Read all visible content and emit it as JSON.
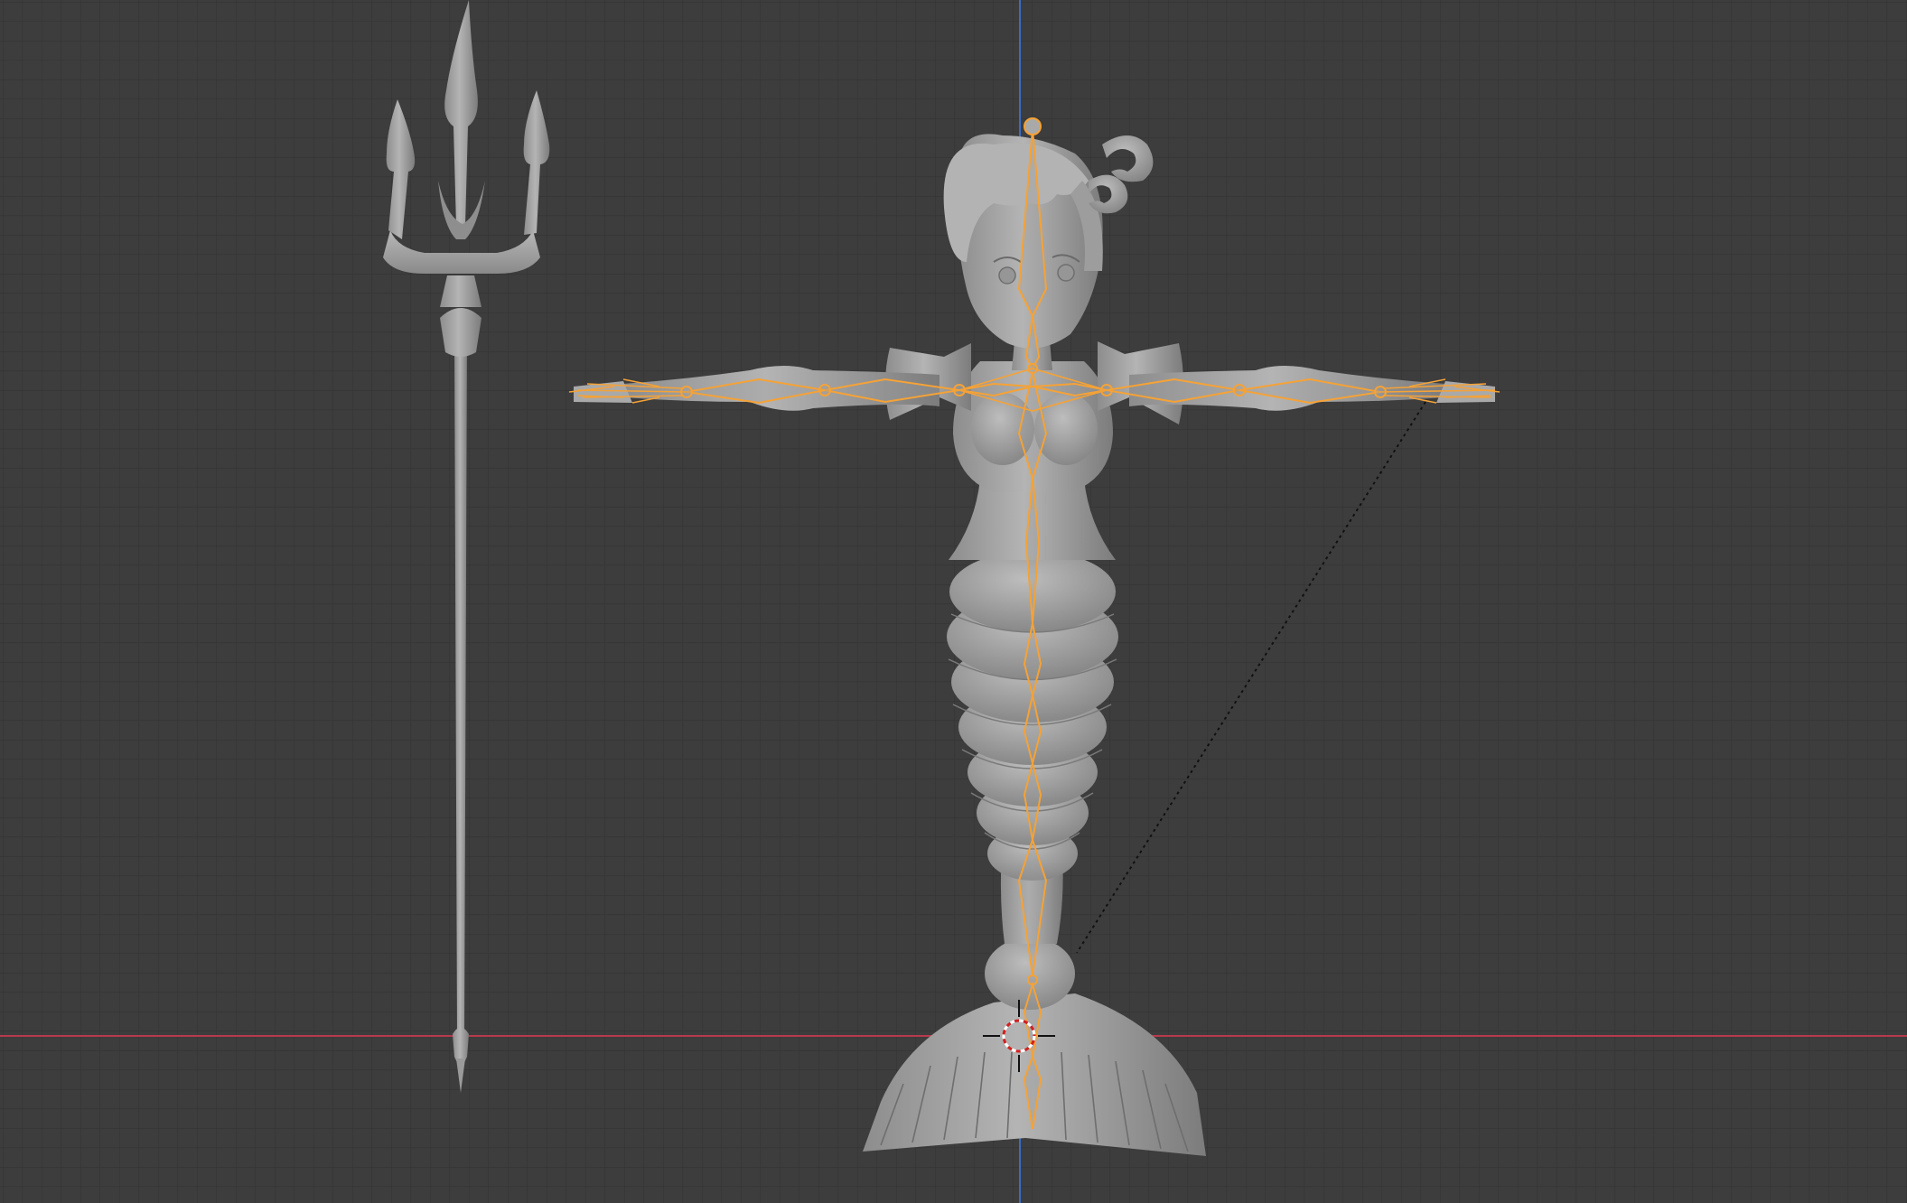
{
  "viewport": {
    "view": "front-orthographic",
    "background_color": "#3d3d3d",
    "grid_color": "#2f2f2f",
    "grid_major_color": "#2a2a2a",
    "x_axis_color": "#c0394a",
    "z_axis_color": "#3a6ec0",
    "mesh_color": "#a8a8a8",
    "armature_color": "#f39c2b",
    "relation_line_color": "#111111",
    "cursor_icon": "3d-cursor-icon"
  },
  "scene": {
    "objects": [
      {
        "name": "trident",
        "type": "mesh",
        "selected": false
      },
      {
        "name": "mermaid-body",
        "type": "mesh",
        "selected": false
      },
      {
        "name": "mermaid-armature",
        "type": "armature",
        "selected": true
      }
    ]
  }
}
